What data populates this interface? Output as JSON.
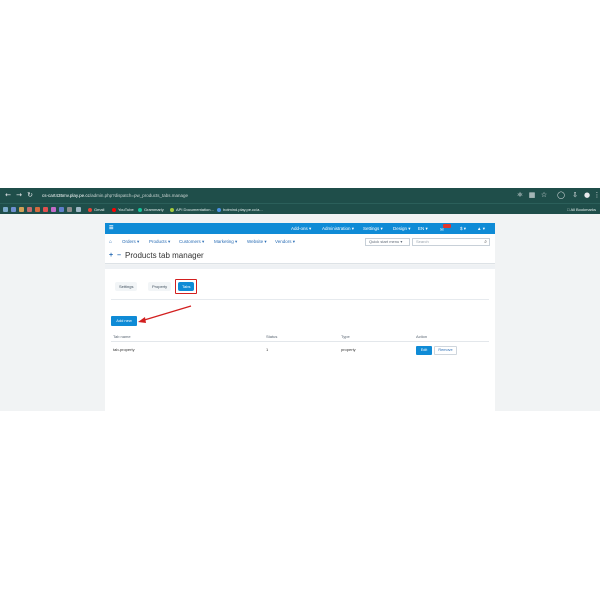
{
  "browser": {
    "url_host": "cs-cart435mv.play.pe.cc",
    "url_path": "/admin.php?dispatch=pw_products_tabs.manage",
    "bookmarks": [
      "Gmail",
      "YouTube",
      "Grammarly",
      "API Documentation...",
      "hotmind.play.pe.cc/a..."
    ],
    "bookmarks_right": "All Bookmarks"
  },
  "topbar": {
    "brand": "☰",
    "menu": [
      "Add-ons ▾",
      "Administration ▾",
      "Settings ▾",
      "Design ▾",
      "EN ▾",
      "$ ▾",
      "▲ ▾"
    ]
  },
  "header": {
    "nav": [
      "Orders ▾",
      "Products ▾",
      "Customers ▾",
      "Marketing ▾",
      "Website ▾",
      "Vendors ▾"
    ],
    "quick_start": "Quick start menu ▾",
    "search_placeholder": "Search",
    "page_title": "Products tab manager"
  },
  "tabs": [
    "Settings",
    "Property",
    "Tabs"
  ],
  "active_tab": "Tabs",
  "add_button": "Add new",
  "table": {
    "headers": [
      "Tab name",
      "Status",
      "Type",
      "Action"
    ],
    "rows": [
      {
        "name": "tab-property",
        "status": "1",
        "type": "property",
        "edit": "Edit",
        "remove": "Remove"
      }
    ]
  },
  "colors": {
    "accent": "#0f8bd6",
    "chrome": "#1f4e4a",
    "annotation": "#d21f1f"
  }
}
